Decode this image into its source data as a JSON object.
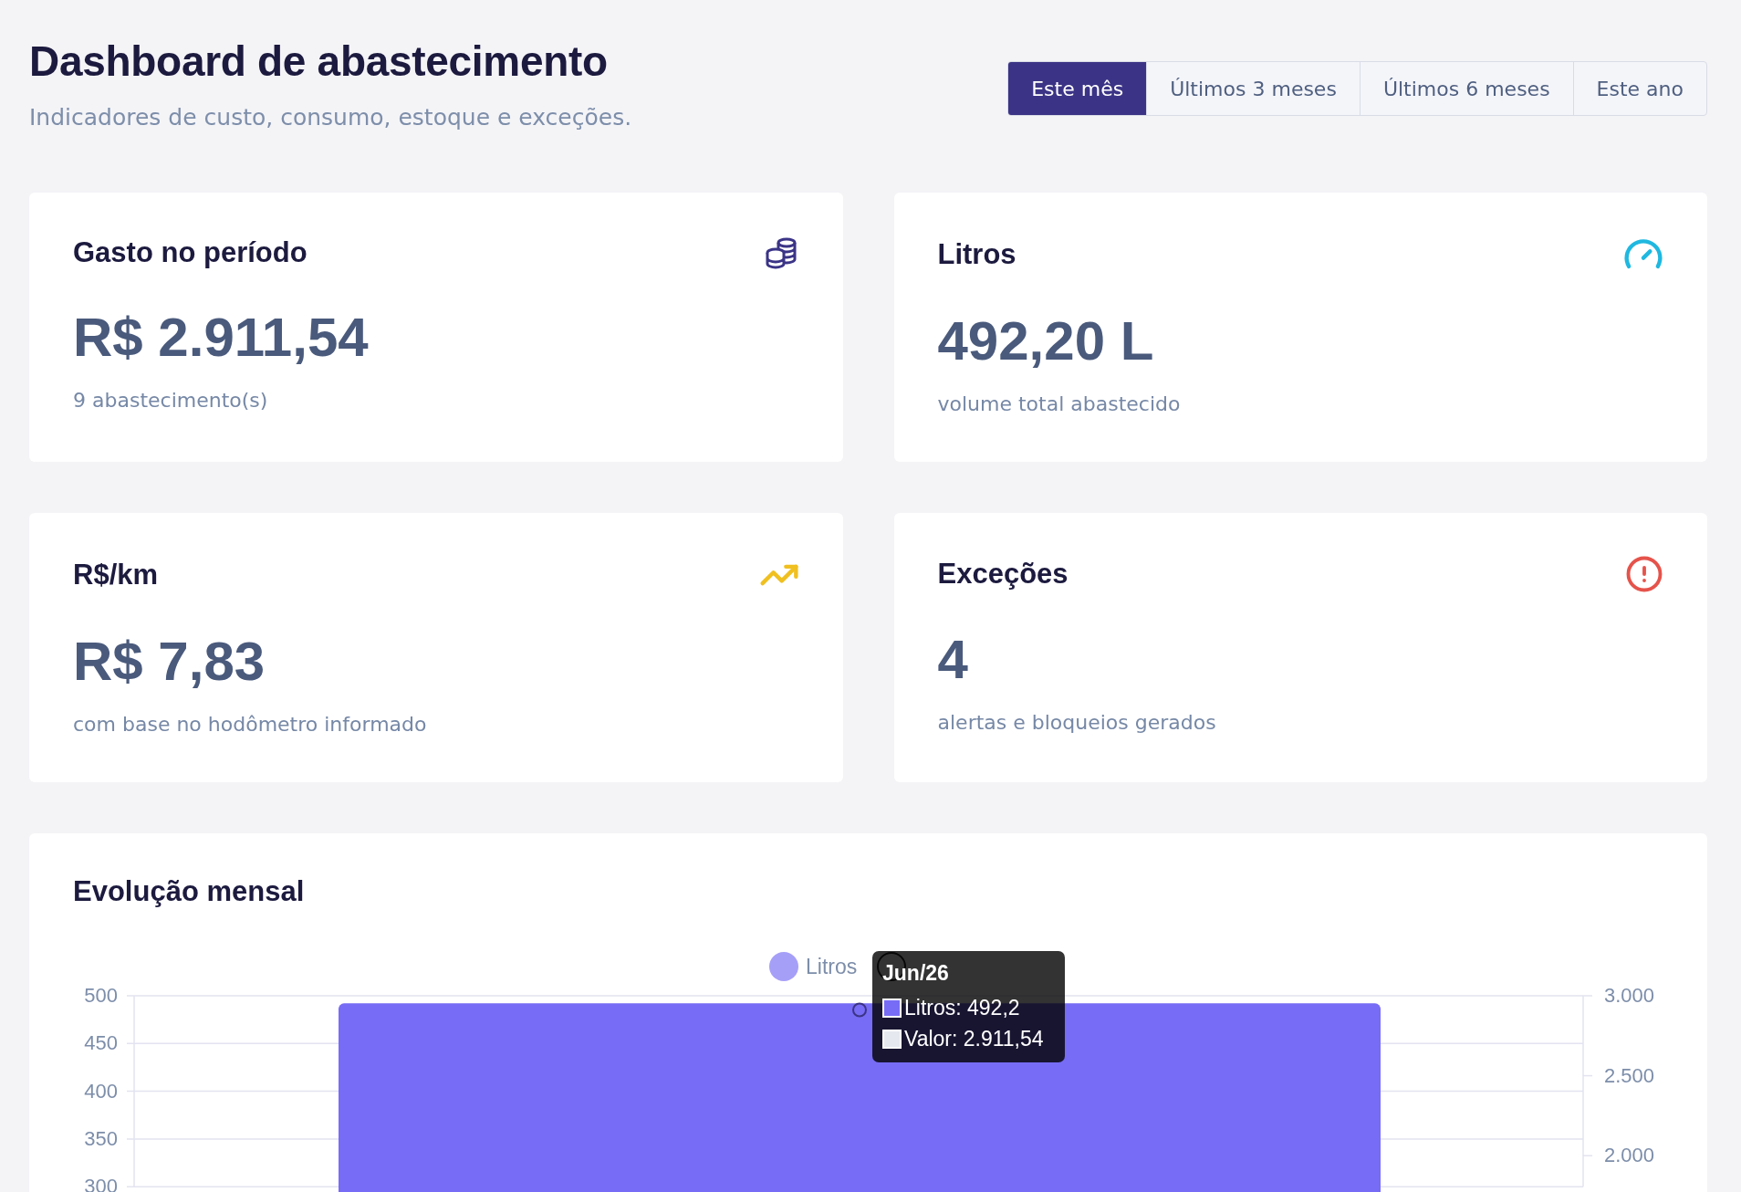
{
  "header": {
    "title": "Dashboard de abastecimento",
    "subtitle": "Indicadores de custo, consumo, estoque e exceções."
  },
  "period_tabs": [
    {
      "label": "Este mês",
      "selected": true
    },
    {
      "label": "Últimos 3 meses",
      "selected": false
    },
    {
      "label": "Últimos 6 meses",
      "selected": false
    },
    {
      "label": "Este ano",
      "selected": false
    }
  ],
  "cards": [
    {
      "kind": "coins",
      "title": "Gasto no período",
      "value": "R$ 2.911,54",
      "caption": "9 abastecimento(s)"
    },
    {
      "kind": "gauge",
      "title": "Litros",
      "value": "492,20 L",
      "caption": "volume total abastecido"
    },
    {
      "kind": "trend",
      "title": "R$/km",
      "value": "R$ 7,83",
      "caption": "com base no hodômetro informado"
    },
    {
      "kind": "alert",
      "title": "Exceções",
      "value": "4",
      "caption": "alertas e bloqueios gerados"
    }
  ],
  "chart": {
    "title": "Evolução mensal",
    "tooltip": {
      "title": "Jun/26",
      "rows": [
        "Litros: 492,2",
        "Valor: 2.911,54"
      ]
    },
    "chart_data": {
      "type": "bar",
      "stacked": false,
      "series": [
        {
          "name": "Litros",
          "color": "#776cf5",
          "values": [
            492
          ]
        }
      ],
      "grid": true,
      "ylim": [
        300,
        500
      ],
      "yticks": [
        300,
        350,
        400,
        450,
        500
      ],
      "y2lim": [
        1806,
        3000
      ],
      "y2ticks": [
        {
          "value": 2000,
          "label": "2.000"
        },
        {
          "value": 2500,
          "label": "2.500"
        },
        {
          "value": 3000,
          "label": "3.000"
        }
      ]
    }
  }
}
